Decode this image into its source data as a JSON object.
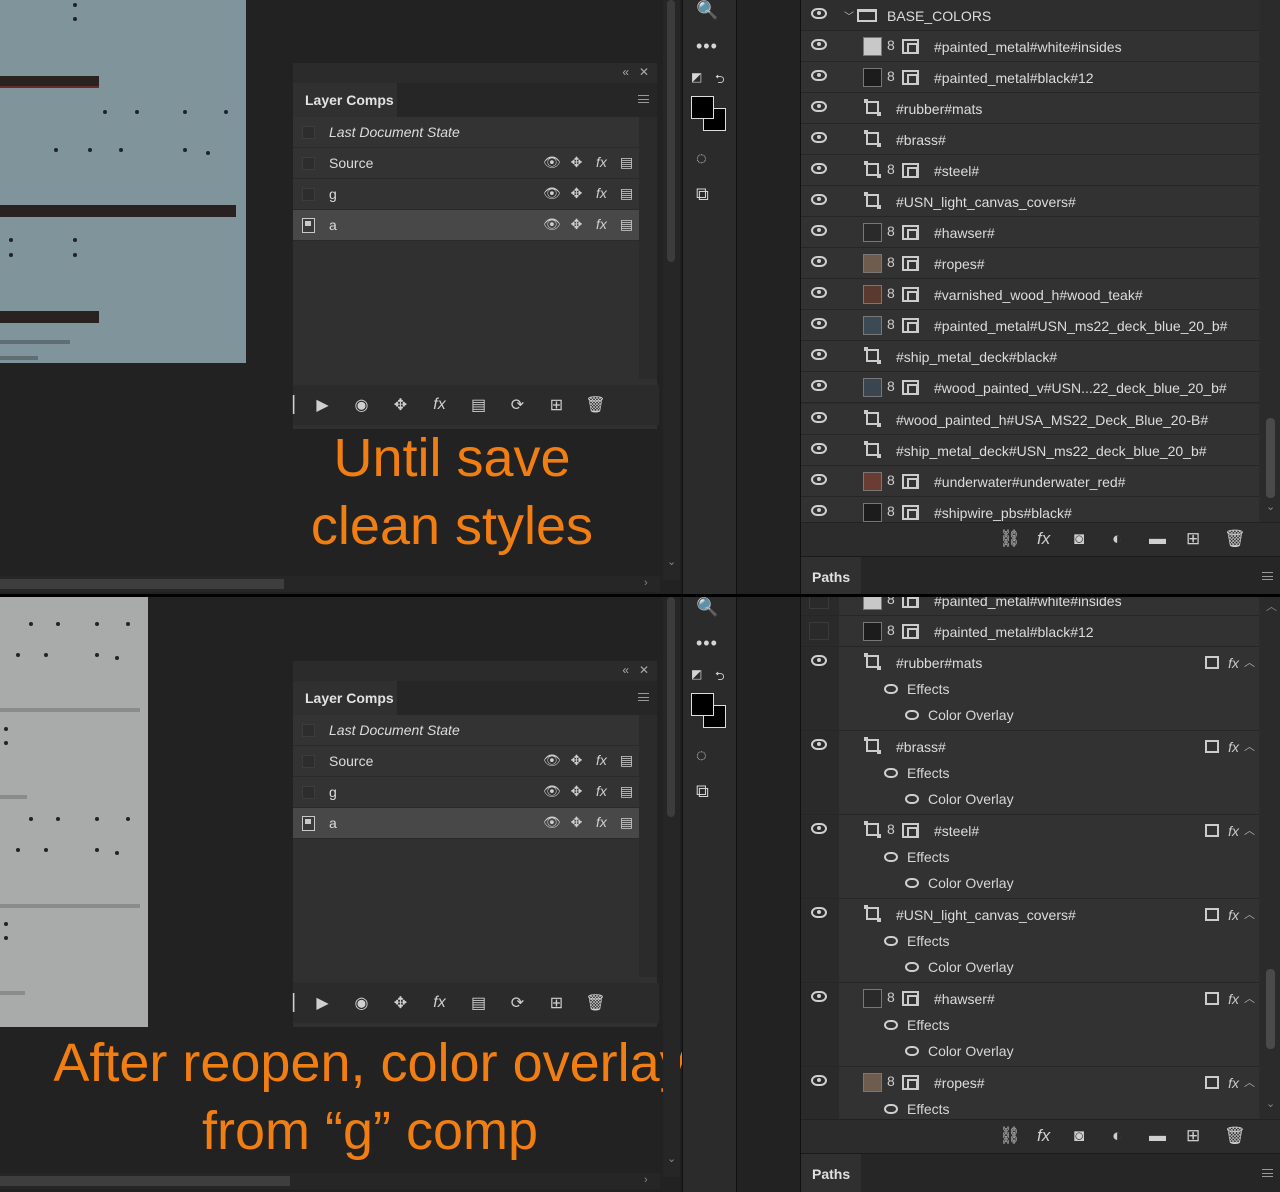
{
  "panels": [
    {
      "caption_lines": [
        "Until save",
        "clean styles"
      ],
      "layer_comps": {
        "tab": "Layer Comps",
        "rows": [
          {
            "label": "Last Document State",
            "italic": true
          },
          {
            "label": "Source"
          },
          {
            "label": "g"
          },
          {
            "label": "a",
            "selected": true
          }
        ]
      },
      "layers": [
        {
          "name": "BASE_COLORS",
          "kind": "group"
        },
        {
          "name": "#painted_metal#white#insides",
          "kind": "smart",
          "thumb": "#c8c8c8"
        },
        {
          "name": "#painted_metal#black#12",
          "kind": "smart",
          "thumb": "#1c1c1c"
        },
        {
          "name": "#rubber#mats",
          "kind": "shape"
        },
        {
          "name": "#brass#",
          "kind": "shape"
        },
        {
          "name": "#steel#",
          "kind": "shape-smart"
        },
        {
          "name": "#USN_light_canvas_covers#",
          "kind": "shape"
        },
        {
          "name": "#hawser#",
          "kind": "smart",
          "thumb": "#2a2a2a"
        },
        {
          "name": "#ropes#",
          "kind": "smart",
          "thumb": "#6e5d4e"
        },
        {
          "name": "#varnished_wood_h#wood_teak#",
          "kind": "smart",
          "thumb": "#5a3a2e"
        },
        {
          "name": "#painted_metal#USN_ms22_deck_blue_20_b#",
          "kind": "smart",
          "thumb": "#3c4a56"
        },
        {
          "name": "#ship_metal_deck#black#",
          "kind": "shape"
        },
        {
          "name": "#wood_painted_v#USN...22_deck_blue_20_b#",
          "kind": "smart",
          "thumb": "#3a4550"
        },
        {
          "name": "#wood_painted_h#USA_MS22_Deck_Blue_20-B#",
          "kind": "shape"
        },
        {
          "name": "#ship_metal_deck#USN_ms22_deck_blue_20_b#",
          "kind": "shape"
        },
        {
          "name": "#underwater#underwater_red#",
          "kind": "smart",
          "thumb": "#6a3c34"
        },
        {
          "name": "#shipwire_pbs#black#",
          "kind": "smart",
          "thumb": "#1c1c1c"
        }
      ],
      "paths_tab": "Paths"
    },
    {
      "caption_lines": [
        "After reopen, color overlay",
        "from “g” comp"
      ],
      "layer_comps": {
        "tab": "Layer Comps",
        "rows": [
          {
            "label": "Last Document State",
            "italic": true
          },
          {
            "label": "Source"
          },
          {
            "label": "g"
          },
          {
            "label": "a",
            "selected": true
          }
        ]
      },
      "layers": [
        {
          "name": "#painted_metal#white#insides",
          "kind": "smart",
          "thumb": "#c8c8c8",
          "partial": true
        },
        {
          "name": "#painted_metal#black#12",
          "kind": "smart",
          "thumb": "#1c1c1c"
        },
        {
          "name": "#rubber#mats",
          "kind": "shape",
          "fx": true
        },
        {
          "name": "#brass#",
          "kind": "shape",
          "fx": true
        },
        {
          "name": "#steel#",
          "kind": "shape-smart",
          "fx": true
        },
        {
          "name": "#USN_light_canvas_covers#",
          "kind": "shape",
          "fx": true
        },
        {
          "name": "#hawser#",
          "kind": "smart",
          "thumb": "#2a2a2a",
          "fx": true
        },
        {
          "name": "#ropes#",
          "kind": "smart",
          "thumb": "#6e5d4e",
          "fx": true
        }
      ],
      "effects_label": "Effects",
      "color_overlay_label": "Color Overlay",
      "paths_tab": "Paths"
    }
  ],
  "icons": {
    "eye": "eye-icon",
    "move": "move-icon",
    "fx": "fx-icon",
    "appearance": "appearance-icon",
    "fx_symbol": "fx"
  },
  "colors": {
    "caption": "#f07e13",
    "top_doc": "#7f949b",
    "bottom_doc": "#a9aaaa"
  }
}
